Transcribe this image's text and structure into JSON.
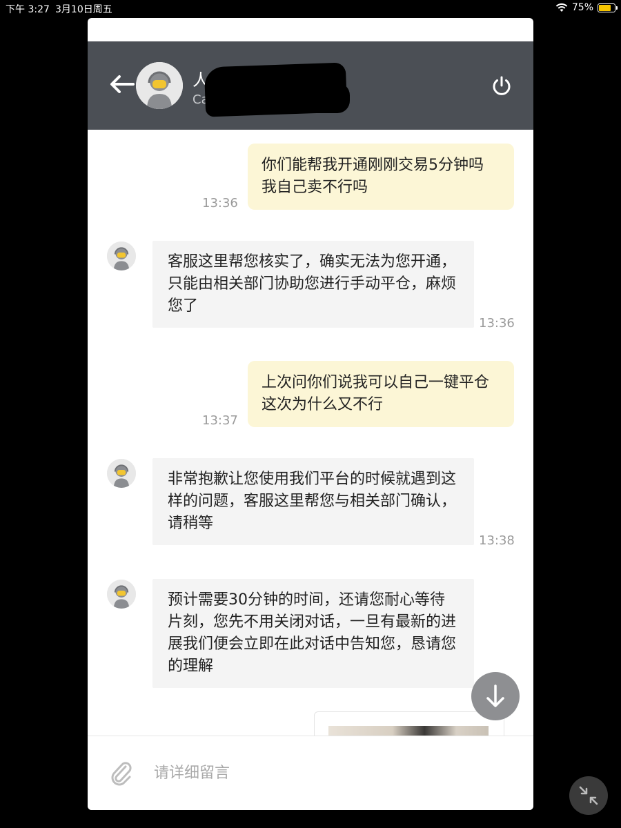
{
  "status_bar": {
    "time": "下午 3:27",
    "date": "3月10日周五",
    "battery": "75%",
    "battery_level": 0.75
  },
  "header": {
    "title": "人工客服",
    "subtitle": "Case"
  },
  "messages": [
    {
      "side": "user",
      "text": "你们能帮我开通刚刚交易5分钟吗 我自己卖不行吗",
      "time": "13:36"
    },
    {
      "side": "agent",
      "text": "客服这里帮您核实了，确实无法为您开通，只能由相关部门协助您进行手动平仓，麻烦您了",
      "time": "13:36"
    },
    {
      "side": "user",
      "text": "上次问你们说我可以自己一键平仓 这次为什么又不行",
      "time": "13:37"
    },
    {
      "side": "agent",
      "text": "非常抱歉让您使用我们平台的时候就遇到这样的问题，客服这里帮您与相关部门确认，请稍等",
      "time": "13:38"
    },
    {
      "side": "agent",
      "text": "预计需要30分钟的时间，还请您耐心等待片刻，您先不用关闭对话，一旦有最新的进展我们便会立即在此对话中告知您，恳请您的理解",
      "time": ""
    }
  ],
  "input": {
    "placeholder": "请详细留言"
  },
  "icons": {
    "back": "arrow-left-icon",
    "power": "power-icon",
    "attach": "paperclip-icon",
    "scroll": "arrow-down-icon",
    "minimize": "collapse-icon"
  },
  "colors": {
    "header_bg": "#4b4f55",
    "user_bubble": "#fcf6d6",
    "agent_bubble": "#f4f4f4",
    "battery": "#f5c400"
  }
}
